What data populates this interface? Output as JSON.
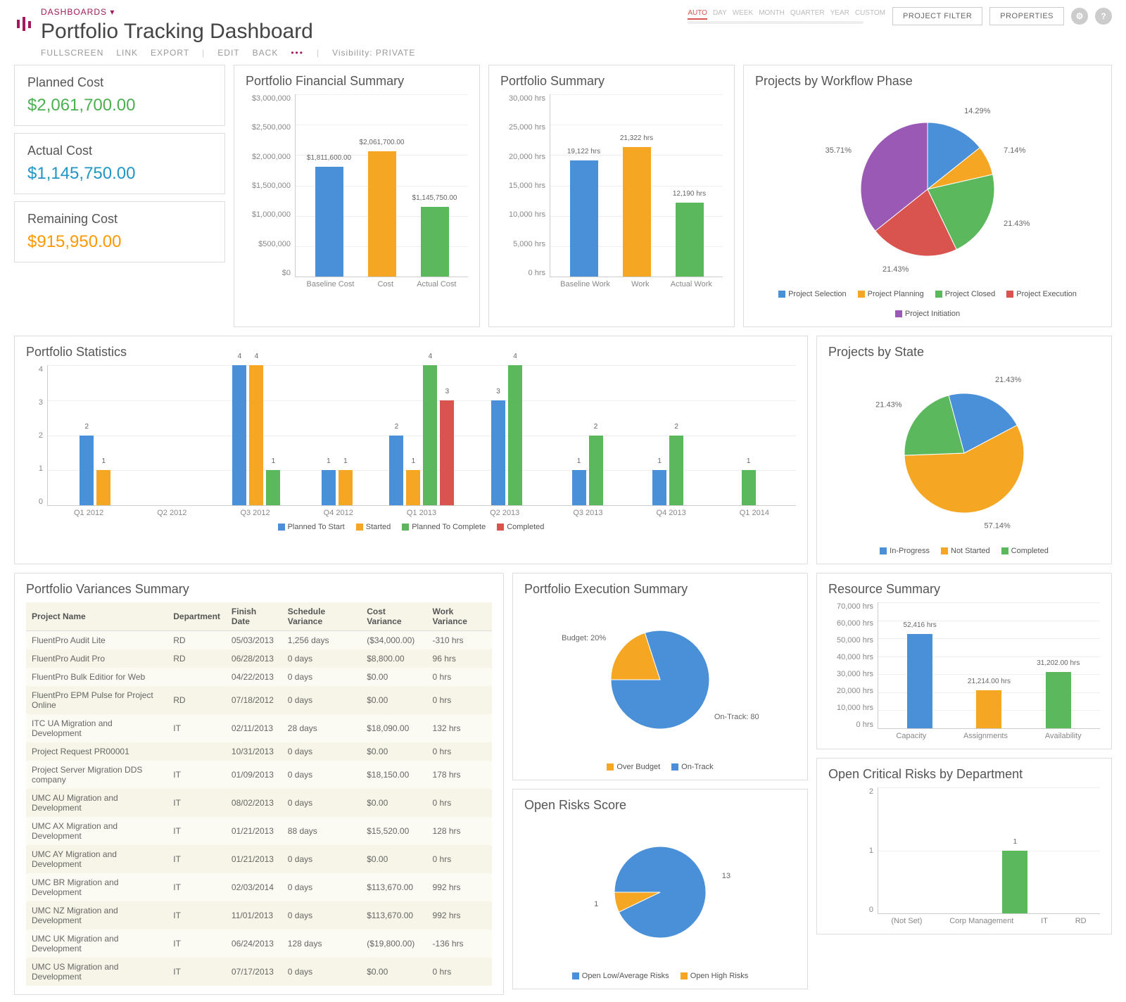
{
  "header": {
    "breadcrumb": "DASHBOARDS",
    "title": "Portfolio Tracking Dashboard",
    "toolbar": {
      "fullscreen": "FULLSCREEN",
      "link": "LINK",
      "export": "EXPORT",
      "edit": "EDIT",
      "back": "BACK",
      "more": "•••",
      "visibility_label": "Visibility: PRIVATE"
    },
    "scale": [
      "AUTO",
      "DAY",
      "WEEK",
      "MONTH",
      "QUARTER",
      "YEAR",
      "CUSTOM"
    ],
    "scale_active": "AUTO",
    "project_filter": "PROJECT FILTER",
    "properties": "PROPERTIES"
  },
  "kpis": {
    "planned_label": "Planned Cost",
    "planned_value": "$2,061,700.00",
    "actual_label": "Actual Cost",
    "actual_value": "$1,145,750.00",
    "remaining_label": "Remaining Cost",
    "remaining_value": "$915,950.00"
  },
  "financial_summary": {
    "title": "Portfolio Financial Summary",
    "y_ticks": [
      "$3,000,000",
      "$2,500,000",
      "$2,000,000",
      "$1,500,000",
      "$1,000,000",
      "$500,000",
      "$0"
    ],
    "categories": [
      "Baseline Cost",
      "Cost",
      "Actual Cost"
    ],
    "bars": [
      {
        "label": "$1,811,600.00",
        "color": "blue",
        "h": 60.4
      },
      {
        "label": "$2,061,700.00",
        "color": "orange",
        "h": 68.7
      },
      {
        "label": "$1,145,750.00",
        "color": "green",
        "h": 38.2
      }
    ]
  },
  "portfolio_summary": {
    "title": "Portfolio Summary",
    "y_ticks": [
      "30,000 hrs",
      "25,000 hrs",
      "20,000 hrs",
      "15,000 hrs",
      "10,000 hrs",
      "5,000 hrs",
      "0 hrs"
    ],
    "categories": [
      "Baseline Work",
      "Work",
      "Actual Work"
    ],
    "bars": [
      {
        "label": "19,122 hrs",
        "color": "blue",
        "h": 63.7
      },
      {
        "label": "21,322 hrs",
        "color": "orange",
        "h": 71.1
      },
      {
        "label": "12,190 hrs",
        "color": "green",
        "h": 40.6
      }
    ]
  },
  "workflow_phase": {
    "title": "Projects by Workflow Phase",
    "legend": [
      "Project Selection",
      "Project Planning",
      "Project Closed",
      "Project Execution",
      "Project Initiation"
    ],
    "data": [
      {
        "label": "14.29%",
        "value": 14.29,
        "color": "#4a90d9"
      },
      {
        "label": "7.14%",
        "value": 7.14,
        "color": "#f5a623"
      },
      {
        "label": "21.43%",
        "value": 21.43,
        "color": "#5cb85c"
      },
      {
        "label": "21.43%",
        "value": 21.43,
        "color": "#d9534f"
      },
      {
        "label": "35.71%",
        "value": 35.71,
        "color": "#9b59b6"
      }
    ]
  },
  "portfolio_statistics": {
    "title": "Portfolio Statistics",
    "y_ticks": [
      "4",
      "3",
      "2",
      "1",
      "0"
    ],
    "categories": [
      "Q1 2012",
      "Q2 2012",
      "Q3 2012",
      "Q4 2012",
      "Q1 2013",
      "Q2 2013",
      "Q3 2013",
      "Q4 2013",
      "Q1 2014"
    ],
    "series_legend": [
      "Planned To Start",
      "Started",
      "Planned To Complete",
      "Completed"
    ],
    "groups": [
      [
        {
          "v": 2,
          "c": "blue"
        },
        {
          "v": 1,
          "c": "orange"
        }
      ],
      [],
      [
        {
          "v": 4,
          "c": "blue"
        },
        {
          "v": 4,
          "c": "orange"
        },
        {
          "v": 1,
          "c": "green"
        }
      ],
      [
        {
          "v": 1,
          "c": "blue"
        },
        {
          "v": 1,
          "c": "orange"
        }
      ],
      [
        {
          "v": 2,
          "c": "blue"
        },
        {
          "v": 1,
          "c": "orange"
        },
        {
          "v": 4,
          "c": "green"
        },
        {
          "v": 3,
          "c": "red"
        }
      ],
      [
        {
          "v": 3,
          "c": "blue"
        },
        {
          "v": 4,
          "c": "green"
        }
      ],
      [
        {
          "v": 1,
          "c": "blue"
        },
        {
          "v": 2,
          "c": "green"
        }
      ],
      [
        {
          "v": 1,
          "c": "blue"
        },
        {
          "v": 2,
          "c": "green"
        }
      ],
      [
        {
          "v": 1,
          "c": "green"
        }
      ]
    ]
  },
  "projects_by_state": {
    "title": "Projects by State",
    "legend": [
      "In-Progress",
      "Not Started",
      "Completed"
    ],
    "data": [
      {
        "label": "21.43%",
        "value": 21.43,
        "color": "#4a90d9"
      },
      {
        "label": "57.14%",
        "value": 57.14,
        "color": "#f5a623"
      },
      {
        "label": "21.43%",
        "value": 21.43,
        "color": "#5cb85c"
      }
    ]
  },
  "variances": {
    "title": "Portfolio Variances Summary",
    "columns": [
      "Project Name",
      "Department",
      "Finish Date",
      "Schedule Variance",
      "Cost Variance",
      "Work Variance"
    ],
    "rows": [
      [
        "FluentPro Audit Lite",
        "RD",
        "05/03/2013",
        "1,256 days",
        "($34,000.00)",
        "-310 hrs"
      ],
      [
        "FluentPro Audit Pro",
        "RD",
        "06/28/2013",
        "0 days",
        "$8,800.00",
        "96 hrs"
      ],
      [
        "FluentPro Bulk Editior for Web",
        "",
        "04/22/2013",
        "0 days",
        "$0.00",
        "0 hrs"
      ],
      [
        "FluentPro EPM Pulse for Project Online",
        "RD",
        "07/18/2012",
        "0 days",
        "$0.00",
        "0 hrs"
      ],
      [
        "ITC UA Migration and Development",
        "IT",
        "02/11/2013",
        "28 days",
        "$18,090.00",
        "132 hrs"
      ],
      [
        "Project Request PR00001",
        "",
        "10/31/2013",
        "0 days",
        "$0.00",
        "0 hrs"
      ],
      [
        "Project Server Migration DDS company",
        "IT",
        "01/09/2013",
        "0 days",
        "$18,150.00",
        "178 hrs"
      ],
      [
        "UMC AU Migration and Development",
        "IT",
        "08/02/2013",
        "0 days",
        "$0.00",
        "0 hrs"
      ],
      [
        "UMC AX Migration and Development",
        "IT",
        "01/21/2013",
        "88 days",
        "$15,520.00",
        "128 hrs"
      ],
      [
        "UMC AY Migration and Development",
        "IT",
        "01/21/2013",
        "0 days",
        "$0.00",
        "0 hrs"
      ],
      [
        "UMC BR Migration and Development",
        "IT",
        "02/03/2014",
        "0 days",
        "$113,670.00",
        "992 hrs"
      ],
      [
        "UMC NZ Migration and Development",
        "IT",
        "11/01/2013",
        "0 days",
        "$113,670.00",
        "992 hrs"
      ],
      [
        "UMC UK Migration and Development",
        "IT",
        "06/24/2013",
        "128 days",
        "($19,800.00)",
        "-136 hrs"
      ],
      [
        "UMC US Migration and Development",
        "IT",
        "07/17/2013",
        "0 days",
        "$0.00",
        "0 hrs"
      ]
    ]
  },
  "execution_summary": {
    "title": "Portfolio Execution Summary",
    "legend": [
      "Over Budget",
      "On-Track"
    ],
    "data": [
      {
        "label": "Over Budget: 20%",
        "value": 20,
        "color": "#f5a623"
      },
      {
        "label": "On-Track: 80%",
        "value": 80,
        "color": "#4a90d9"
      }
    ]
  },
  "resource_summary": {
    "title": "Resource Summary",
    "y_ticks": [
      "70,000 hrs",
      "60,000 hrs",
      "50,000 hrs",
      "40,000 hrs",
      "30,000 hrs",
      "20,000 hrs",
      "10,000 hrs",
      "0 hrs"
    ],
    "categories": [
      "Capacity",
      "Assignments",
      "Availability"
    ],
    "bars": [
      {
        "label": "52,416 hrs",
        "color": "blue",
        "h": 74.9
      },
      {
        "label": "21,214.00 hrs",
        "color": "orange",
        "h": 30.3
      },
      {
        "label": "31,202.00 hrs",
        "color": "green",
        "h": 44.6
      }
    ]
  },
  "open_risks": {
    "title": "Open Risks Score",
    "legend": [
      "Open Low/Average Risks",
      "Open High Risks"
    ],
    "data": [
      {
        "label": "13",
        "value": 13,
        "color": "#4a90d9"
      },
      {
        "label": "1",
        "value": 1,
        "color": "#f5a623"
      }
    ]
  },
  "critical_risks": {
    "title": "Open Critical Risks by Department",
    "y_ticks": [
      "2",
      "1",
      "0"
    ],
    "categories": [
      "(Not Set)",
      "Corp Management",
      "IT",
      "RD"
    ],
    "bars": [
      {
        "label": "",
        "color": "blue",
        "h": 0
      },
      {
        "label": "",
        "color": "orange",
        "h": 0
      },
      {
        "label": "1",
        "color": "green",
        "h": 50
      },
      {
        "label": "",
        "color": "red",
        "h": 0
      }
    ]
  },
  "chart_data": [
    {
      "type": "bar",
      "title": "Portfolio Financial Summary",
      "categories": [
        "Baseline Cost",
        "Cost",
        "Actual Cost"
      ],
      "values": [
        1811600,
        2061700,
        1145750
      ],
      "ylabel": "",
      "ylim": [
        0,
        3000000
      ]
    },
    {
      "type": "bar",
      "title": "Portfolio Summary",
      "categories": [
        "Baseline Work",
        "Work",
        "Actual Work"
      ],
      "values": [
        19122,
        21322,
        12190
      ],
      "ylabel": "hrs",
      "ylim": [
        0,
        30000
      ]
    },
    {
      "type": "pie",
      "title": "Projects by Workflow Phase",
      "categories": [
        "Project Selection",
        "Project Planning",
        "Project Closed",
        "Project Execution",
        "Project Initiation"
      ],
      "values": [
        14.29,
        7.14,
        21.43,
        21.43,
        35.71
      ]
    },
    {
      "type": "bar",
      "title": "Portfolio Statistics",
      "categories": [
        "Q1 2012",
        "Q2 2012",
        "Q3 2012",
        "Q4 2012",
        "Q1 2013",
        "Q2 2013",
        "Q3 2013",
        "Q4 2013",
        "Q1 2014"
      ],
      "series": [
        {
          "name": "Planned To Start",
          "values": [
            2,
            0,
            4,
            1,
            2,
            3,
            1,
            1,
            0
          ]
        },
        {
          "name": "Started",
          "values": [
            1,
            0,
            4,
            1,
            1,
            0,
            0,
            0,
            0
          ]
        },
        {
          "name": "Planned To Complete",
          "values": [
            0,
            0,
            1,
            0,
            4,
            4,
            2,
            2,
            1
          ]
        },
        {
          "name": "Completed",
          "values": [
            0,
            0,
            0,
            0,
            3,
            0,
            0,
            0,
            0
          ]
        }
      ],
      "ylim": [
        0,
        4
      ]
    },
    {
      "type": "pie",
      "title": "Projects by State",
      "categories": [
        "In-Progress",
        "Not Started",
        "Completed"
      ],
      "values": [
        21.43,
        57.14,
        21.43
      ]
    },
    {
      "type": "pie",
      "title": "Portfolio Execution Summary",
      "categories": [
        "Over Budget",
        "On-Track"
      ],
      "values": [
        20,
        80
      ]
    },
    {
      "type": "bar",
      "title": "Resource Summary",
      "categories": [
        "Capacity",
        "Assignments",
        "Availability"
      ],
      "values": [
        52416,
        21214,
        31202
      ],
      "ylabel": "hrs",
      "ylim": [
        0,
        70000
      ]
    },
    {
      "type": "pie",
      "title": "Open Risks Score",
      "categories": [
        "Open Low/Average Risks",
        "Open High Risks"
      ],
      "values": [
        13,
        1
      ]
    },
    {
      "type": "bar",
      "title": "Open Critical Risks by Department",
      "categories": [
        "(Not Set)",
        "Corp Management",
        "IT",
        "RD"
      ],
      "values": [
        0,
        0,
        1,
        0
      ],
      "ylim": [
        0,
        2
      ]
    }
  ]
}
